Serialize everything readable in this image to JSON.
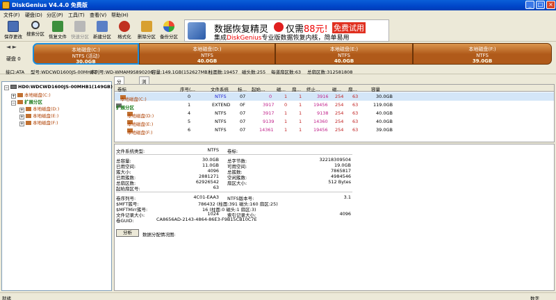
{
  "window": {
    "title": "DiskGenius V4.4.0 免费版",
    "min": "_",
    "max": "□",
    "close": "×"
  },
  "menu": [
    "文件(F)",
    "硬盘(D)",
    "分区(P)",
    "工具(T)",
    "查看(V)",
    "帮助(H)"
  ],
  "toolbar": [
    {
      "label": "保存更改",
      "icon": "save-icon",
      "enabled": true
    },
    {
      "label": "搜索分区",
      "icon": "search-icon",
      "enabled": true
    },
    {
      "label": "恢复文件",
      "icon": "restore-icon",
      "enabled": true
    },
    {
      "label": "快速分区",
      "icon": "quick-partition-icon",
      "enabled": false
    },
    {
      "label": "新建分区",
      "icon": "new-partition-icon",
      "enabled": true
    },
    {
      "label": "格式化",
      "icon": "format-icon",
      "enabled": true
    },
    {
      "label": "删除分区",
      "icon": "delete-partition-icon",
      "enabled": true
    },
    {
      "label": "备份分区",
      "icon": "backup-partition-icon",
      "enabled": true
    }
  ],
  "banner": {
    "line1a": "数据恢复精灵",
    "line1b_pre": "仅需",
    "line1b_price": "88元!",
    "line1c": "免费试用",
    "line2_pre": "集成",
    "line2_brand": "DiskGenius",
    "line2_post": "专业版数据恢复内核，简单易用"
  },
  "diskmap": {
    "disk_label": "硬盘 0",
    "arrows": "◄ ►",
    "partitions": [
      {
        "name": "本地磁盘(C:)",
        "fs": "NTFS (活动)",
        "size": "30.0GB",
        "active": true
      },
      {
        "name": "本地磁盘(D:)",
        "fs": "NTFS",
        "size": "40.0GB",
        "active": false
      },
      {
        "name": "本地磁盘(E:)",
        "fs": "NTFS",
        "size": "40.0GB",
        "active": false
      },
      {
        "name": "本地磁盘(F:)",
        "fs": "NTFS",
        "size": "39.0GB",
        "active": false
      }
    ]
  },
  "infoline": {
    "iface": "接口:ATA",
    "model": "型号:WDCWD1600JS-00MHB1",
    "serial": "序列号:WD-WMAM9S890206",
    "capacity": "容量:149.1GB(152627MB)",
    "cyl": "柱面数:19457",
    "heads": "磁头数:255",
    "spt": "每道扇区数:63",
    "sectors": "总扇区数:312581808"
  },
  "tree": {
    "disk": "HD0:WDCWD1600JS-00MHB1(149GB)",
    "c": "本地磁盘(C:)",
    "ext": "扩展分区",
    "d": "本地磁盘(D:)",
    "e": "本地磁盘(E:)",
    "f": "本地磁盘(F:)"
  },
  "tabs": [
    "分区参数",
    "浏览文件"
  ],
  "table": {
    "headers": [
      "卷标",
      "序号(…",
      "文件系统",
      "标…",
      "起始…",
      "磁…",
      "扇…",
      "终止…",
      "磁…",
      "扇…",
      "容量"
    ],
    "rows": [
      {
        "name": "本地磁盘(C:)",
        "idx": "0",
        "fs": "NTFS",
        "id": "07",
        "sc": "0",
        "sh": "1",
        "ss": "1",
        "ec": "3916",
        "eh": "254",
        "es": "63",
        "cap": "30.0GB"
      },
      {
        "name": "扩展分区",
        "idx": "1",
        "fs": "EXTEND",
        "id": "0F",
        "sc": "3917",
        "sh": "0",
        "ss": "1",
        "ec": "19456",
        "eh": "254",
        "es": "63",
        "cap": "119.0GB"
      },
      {
        "name": "本地磁盘(D:)",
        "idx": "4",
        "fs": "NTFS",
        "id": "07",
        "sc": "3917",
        "sh": "1",
        "ss": "1",
        "ec": "9138",
        "eh": "254",
        "es": "63",
        "cap": "40.0GB"
      },
      {
        "name": "本地磁盘(E:)",
        "idx": "5",
        "fs": "NTFS",
        "id": "07",
        "sc": "9139",
        "sh": "1",
        "ss": "1",
        "ec": "14360",
        "eh": "254",
        "es": "63",
        "cap": "40.0GB"
      },
      {
        "name": "本地磁盘(F:)",
        "idx": "6",
        "fs": "NTFS",
        "id": "07",
        "sc": "14361",
        "sh": "1",
        "ss": "1",
        "ec": "19456",
        "eh": "254",
        "es": "63",
        "cap": "39.0GB"
      }
    ]
  },
  "details": {
    "fs_type_label": "文件系统类型:",
    "fs_type": "NTFS",
    "vol_label": "卷标:",
    "total_label": "总容量:",
    "total": "30.0GB",
    "total_bytes_label": "总字节数:",
    "total_bytes": "32218309504",
    "used_label": "已用空间:",
    "used": "11.0GB",
    "free_label": "可用空间:",
    "free": "19.0GB",
    "cluster_label": "簇大小:",
    "cluster": "4096",
    "clusters_label": "总簇数:",
    "clusters": "7865817",
    "used_cl_label": "已用簇数:",
    "used_cl": "2881271",
    "free_cl_label": "空闲簇数:",
    "free_cl": "4984546",
    "sectors_label": "总扇区数:",
    "sectors": "62926542",
    "sector_size_label": "扇区大小:",
    "sector_size": "512 Bytes",
    "start_label": "起始扇区号:",
    "start": "63",
    "serial_label": "卷序列号:",
    "serial": "4C01-EAA3",
    "ntfs_ver_label": "NTFS版本号:",
    "ntfs_ver": "3.1",
    "mft_label": "$MFT簇号:",
    "mft": "786432 (柱面:391 磁头:160 扇区:25)",
    "mftmirr_label": "$MFTMirr簇号:",
    "mftmirr": "16 (柱面:0 磁头:1 扇区:3)",
    "rec_size_label": "文件记录大小:",
    "rec_size": "1024",
    "idx_size_label": "索引记录大小:",
    "idx_size": "4096",
    "guid_label": "卷GUID:",
    "guid": "CA8656AD-2143-4864-86E3-F9B15CB10C7E",
    "analyze": "分析",
    "alloc_label": "数据分配情况图:"
  },
  "status": {
    "left": "就绪",
    "right": "数字"
  }
}
